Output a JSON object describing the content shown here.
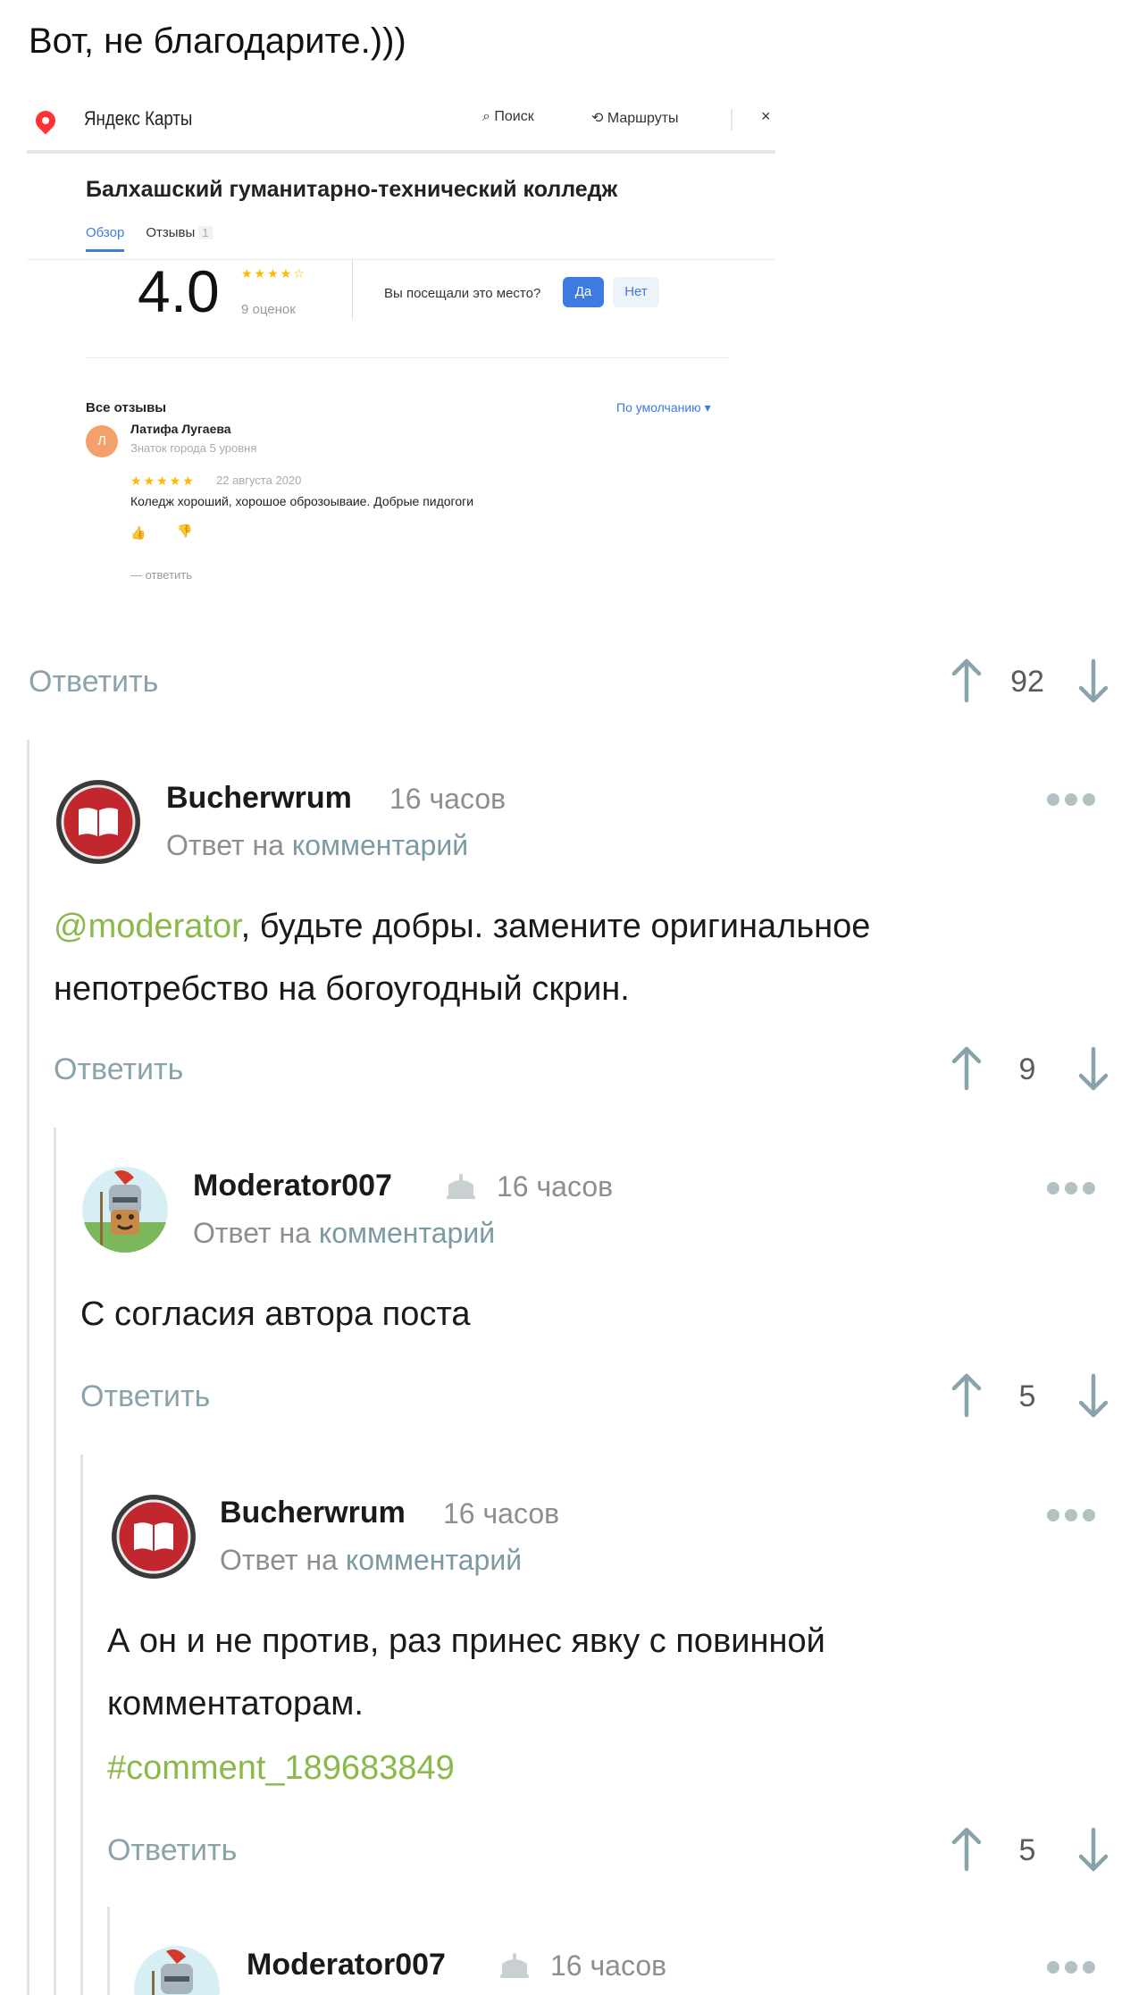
{
  "post": {
    "text": "Вот, не благодарите.)))",
    "embedded_screenshot": {
      "logo": "Яндекс Карты",
      "search_label": "Поиск",
      "routes_label": "Маршруты",
      "close": "×",
      "title": "Балхашский гуманитарно-технический колледж",
      "tab_overview": "Обзор",
      "tab_reviews": "Отзывы",
      "tab_reviews_count": "1",
      "rating": "4.0",
      "stars": "★★★★☆",
      "ratings_count": "9 оценок",
      "visited_question": "Вы посещали это место?",
      "yes": "Да",
      "no": "Нет",
      "all_reviews": "Все отзывы",
      "sort": "По умолчанию ▾",
      "review": {
        "avatar_letter": "Л",
        "author": "Латифа Лугаева",
        "level": "Знаток города 5 уровня",
        "stars": "★★★★★",
        "date": "22 августа 2020",
        "text": "Коледж хороший, хорошое оброзоываие. Добрые пидогоги",
        "reply": "— ответить"
      }
    },
    "reply_label": "Ответить",
    "votes": "92"
  },
  "comments": [
    {
      "author": "Bucherwrum",
      "time": "16 часов",
      "reply_prefix": "Ответ на",
      "reply_link": "комментарий",
      "mention": "@moderator",
      "line1": ", будьте добры. замените оригинальное",
      "line2": "непотребство на богоугодный скрин.",
      "reply_label": "Ответить",
      "votes": "9"
    },
    {
      "author": "Moderator007",
      "time": "16 часов",
      "reply_prefix": "Ответ на",
      "reply_link": "комментарий",
      "line1": "С согласия автора поста",
      "reply_label": "Ответить",
      "votes": "5"
    },
    {
      "author": "Bucherwrum",
      "time": "16 часов",
      "reply_prefix": "Ответ на",
      "reply_link": "комментарий",
      "line1": "А он и не против, раз принес явку с повинной",
      "line2": "комментаторам.",
      "hashlink": "#comment_189683849",
      "reply_label": "Ответить",
      "votes": "5"
    },
    {
      "author": "Moderator007",
      "time": "16 часов"
    }
  ],
  "colors": {
    "accent_green": "#8ab94a",
    "muted_link": "#8aa3ab",
    "yandex_blue": "#3d7be2"
  },
  "icons": [
    "map-pin-icon",
    "search-icon",
    "routes-icon",
    "close-icon",
    "upvote-icon",
    "downvote-icon",
    "more-icon",
    "cake-icon",
    "book-avatar-icon",
    "knight-avatar-icon"
  ]
}
